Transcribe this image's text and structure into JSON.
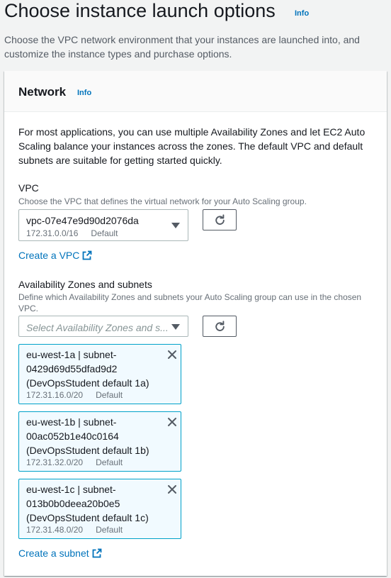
{
  "header": {
    "title": "Choose instance launch options",
    "info": "Info",
    "description": "Choose the VPC network environment that your instances are launched into, and customize the instance types and purchase options."
  },
  "network": {
    "title": "Network",
    "info": "Info",
    "intro": "For most applications, you can use multiple Availability Zones and let EC2 Auto Scaling balance your instances across the zones. The default VPC and default subnets are suitable for getting started quickly.",
    "vpc": {
      "label": "VPC",
      "description": "Choose the VPC that defines the virtual network for your Auto Scaling group.",
      "selected_value": "vpc-07e47e9d90d2076da",
      "selected_cidr": "172.31.0.0/16",
      "selected_tag": "Default",
      "create_link": "Create a VPC"
    },
    "subnets": {
      "label": "Availability Zones and subnets",
      "description": "Define which Availability Zones and subnets your Auto Scaling group can use in the chosen VPC.",
      "placeholder": "Select Availability Zones and s...",
      "tokens": [
        {
          "line1": "eu-west-1a | subnet-",
          "line2": "0429d69d55dfad9d2",
          "line3": "(DevOpsStudent default 1a)",
          "cidr": "172.31.16.0/20",
          "tag": "Default"
        },
        {
          "line1": "eu-west-1b | subnet-",
          "line2": "00ac052b1e40c0164",
          "line3": "(DevOpsStudent default 1b)",
          "cidr": "172.31.32.0/20",
          "tag": "Default"
        },
        {
          "line1": "eu-west-1c | subnet-",
          "line2": "013b0b0deea20b0e5",
          "line3": "(DevOpsStudent default 1c)",
          "cidr": "172.31.48.0/20",
          "tag": "Default"
        }
      ],
      "create_link": "Create a subnet"
    }
  },
  "icons": {
    "refresh": "refresh-icon",
    "caret": "caret-down-icon",
    "external": "external-link-icon",
    "close": "close-icon"
  },
  "colors": {
    "link": "#0073bb",
    "token_bg": "#f1faff",
    "token_border": "#00a1c9",
    "page_bg": "#f2f3f3"
  }
}
